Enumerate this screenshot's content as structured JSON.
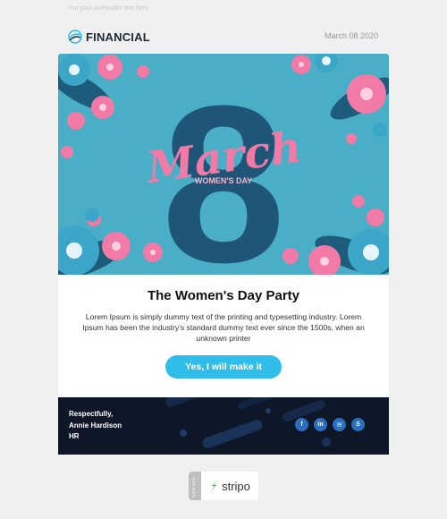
{
  "preheader": "Put your preheader text here",
  "header": {
    "logo_text": "FINANCIAL",
    "date": "March 08.2020"
  },
  "hero": {
    "big_number": "8",
    "script_word": "March",
    "caption": "WOMEN'S DAY"
  },
  "content": {
    "title": "The Women's Day Party",
    "text": "Lorem Ipsum is simply dummy text of the printing and typesetting industry. Lorem Ipsum has been the industry's standard dummy text ever since the 1500s, when an unknown printer",
    "cta_label": "Yes, I will make it"
  },
  "footer": {
    "signature_lines": [
      "Respectfully,",
      "Annie Hardison",
      "HR"
    ],
    "socials": [
      {
        "icon": "facebook-icon",
        "glyph": "f"
      },
      {
        "icon": "linkedin-icon",
        "glyph": "in"
      },
      {
        "icon": "mail-icon",
        "glyph": "✉"
      },
      {
        "icon": "skype-icon",
        "glyph": "S"
      }
    ]
  },
  "badge": {
    "side_text": "MADE WITH",
    "brand": "stripo"
  },
  "colors": {
    "hero_bg": "#4aaec6",
    "hero_number": "#1f5576",
    "pink": "#f27aa6",
    "cta": "#2fbde9",
    "footer_bg": "#0d1727",
    "social": "#2a6fbf",
    "stripo_green": "#39b54a"
  }
}
